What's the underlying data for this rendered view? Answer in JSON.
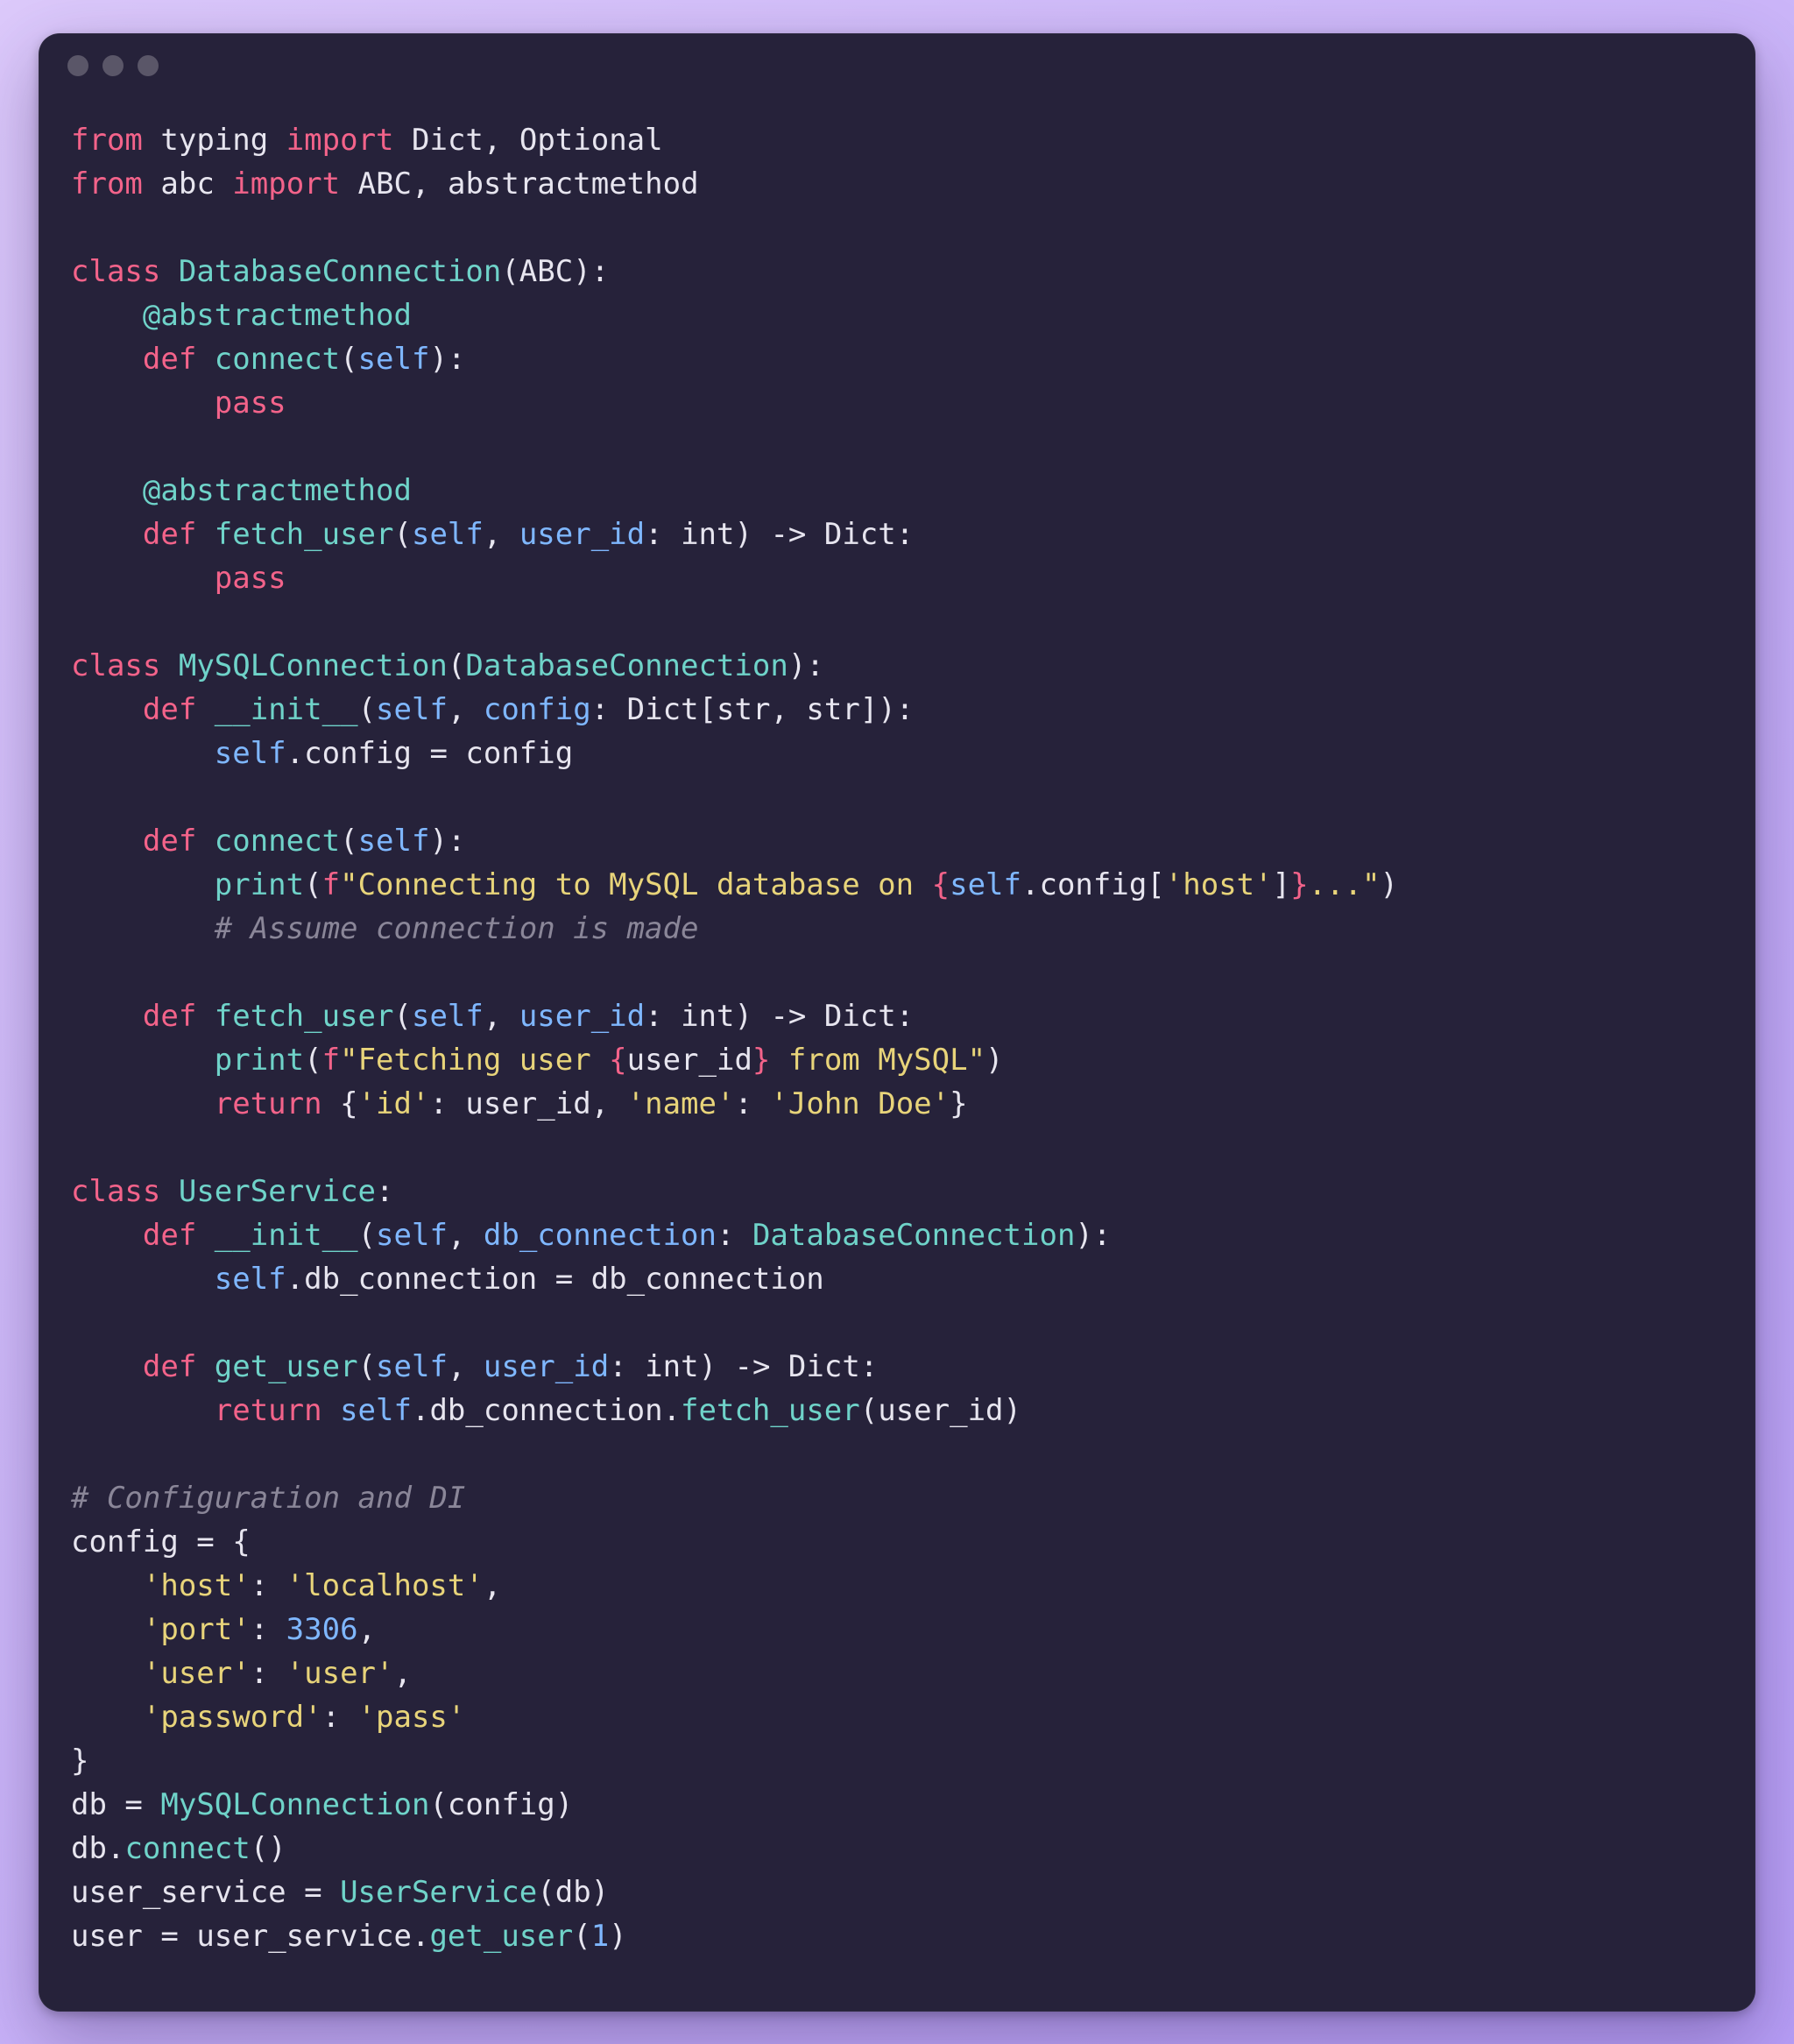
{
  "window": {
    "traffic_light_color_red": "#ff5f56",
    "traffic_light_color_yellow": "#ffbd2e",
    "traffic_light_color_green": "#27c93f"
  },
  "code": {
    "language": "python",
    "tokens": [
      [
        [
          "kw",
          "from"
        ],
        [
          "pun",
          " "
        ],
        [
          "pun",
          "typing"
        ],
        [
          "pun",
          " "
        ],
        [
          "kw",
          "import"
        ],
        [
          "pun",
          " "
        ],
        [
          "pun",
          "Dict"
        ],
        [
          "pun",
          ", "
        ],
        [
          "pun",
          "Optional"
        ]
      ],
      [
        [
          "kw",
          "from"
        ],
        [
          "pun",
          " "
        ],
        [
          "pun",
          "abc"
        ],
        [
          "pun",
          " "
        ],
        [
          "kw",
          "import"
        ],
        [
          "pun",
          " "
        ],
        [
          "pun",
          "ABC"
        ],
        [
          "pun",
          ", "
        ],
        [
          "pun",
          "abstractmethod"
        ]
      ],
      [],
      [
        [
          "kw",
          "class"
        ],
        [
          "pun",
          " "
        ],
        [
          "cls",
          "DatabaseConnection"
        ],
        [
          "pun",
          "("
        ],
        [
          "pun",
          "ABC"
        ],
        [
          "pun",
          "):"
        ]
      ],
      [
        [
          "pun",
          "    "
        ],
        [
          "dec",
          "@abstractmethod"
        ]
      ],
      [
        [
          "pun",
          "    "
        ],
        [
          "kw",
          "def"
        ],
        [
          "pun",
          " "
        ],
        [
          "fn",
          "connect"
        ],
        [
          "pun",
          "("
        ],
        [
          "self",
          "self"
        ],
        [
          "pun",
          "):"
        ]
      ],
      [
        [
          "pun",
          "        "
        ],
        [
          "kw",
          "pass"
        ]
      ],
      [],
      [
        [
          "pun",
          "    "
        ],
        [
          "dec",
          "@abstractmethod"
        ]
      ],
      [
        [
          "pun",
          "    "
        ],
        [
          "kw",
          "def"
        ],
        [
          "pun",
          " "
        ],
        [
          "fn",
          "fetch_user"
        ],
        [
          "pun",
          "("
        ],
        [
          "self",
          "self"
        ],
        [
          "pun",
          ", "
        ],
        [
          "param",
          "user_id"
        ],
        [
          "pun",
          ": "
        ],
        [
          "type",
          "int"
        ],
        [
          "pun",
          ") -> "
        ],
        [
          "type",
          "Dict"
        ],
        [
          "pun",
          ":"
        ]
      ],
      [
        [
          "pun",
          "        "
        ],
        [
          "kw",
          "pass"
        ]
      ],
      [],
      [
        [
          "kw",
          "class"
        ],
        [
          "pun",
          " "
        ],
        [
          "cls",
          "MySQLConnection"
        ],
        [
          "pun",
          "("
        ],
        [
          "cls",
          "DatabaseConnection"
        ],
        [
          "pun",
          "):"
        ]
      ],
      [
        [
          "pun",
          "    "
        ],
        [
          "kw",
          "def"
        ],
        [
          "pun",
          " "
        ],
        [
          "fn",
          "__init__"
        ],
        [
          "pun",
          "("
        ],
        [
          "self",
          "self"
        ],
        [
          "pun",
          ", "
        ],
        [
          "param",
          "config"
        ],
        [
          "pun",
          ": "
        ],
        [
          "type",
          "Dict"
        ],
        [
          "pun",
          "["
        ],
        [
          "type",
          "str"
        ],
        [
          "pun",
          ", "
        ],
        [
          "type",
          "str"
        ],
        [
          "pun",
          "]):"
        ]
      ],
      [
        [
          "pun",
          "        "
        ],
        [
          "self",
          "self"
        ],
        [
          "pun",
          "."
        ],
        [
          "attr",
          "config"
        ],
        [
          "pun",
          " = "
        ],
        [
          "pun",
          "config"
        ]
      ],
      [],
      [
        [
          "pun",
          "    "
        ],
        [
          "kw",
          "def"
        ],
        [
          "pun",
          " "
        ],
        [
          "fn",
          "connect"
        ],
        [
          "pun",
          "("
        ],
        [
          "self",
          "self"
        ],
        [
          "pun",
          "):"
        ]
      ],
      [
        [
          "pun",
          "        "
        ],
        [
          "fn",
          "print"
        ],
        [
          "pun",
          "("
        ],
        [
          "kw",
          "f"
        ],
        [
          "str",
          "\"Connecting to MySQL database on "
        ],
        [
          "fbr",
          "{"
        ],
        [
          "self",
          "self"
        ],
        [
          "pun",
          "."
        ],
        [
          "attr",
          "config"
        ],
        [
          "pun",
          "["
        ],
        [
          "str",
          "'host'"
        ],
        [
          "pun",
          "]"
        ],
        [
          "fbr",
          "}"
        ],
        [
          "str",
          "...\""
        ],
        [
          "pun",
          ")"
        ]
      ],
      [
        [
          "pun",
          "        "
        ],
        [
          "cmt",
          "# Assume connection is made"
        ]
      ],
      [],
      [
        [
          "pun",
          "    "
        ],
        [
          "kw",
          "def"
        ],
        [
          "pun",
          " "
        ],
        [
          "fn",
          "fetch_user"
        ],
        [
          "pun",
          "("
        ],
        [
          "self",
          "self"
        ],
        [
          "pun",
          ", "
        ],
        [
          "param",
          "user_id"
        ],
        [
          "pun",
          ": "
        ],
        [
          "type",
          "int"
        ],
        [
          "pun",
          ") -> "
        ],
        [
          "type",
          "Dict"
        ],
        [
          "pun",
          ":"
        ]
      ],
      [
        [
          "pun",
          "        "
        ],
        [
          "fn",
          "print"
        ],
        [
          "pun",
          "("
        ],
        [
          "kw",
          "f"
        ],
        [
          "str",
          "\"Fetching user "
        ],
        [
          "fbr",
          "{"
        ],
        [
          "pun",
          "user_id"
        ],
        [
          "fbr",
          "}"
        ],
        [
          "str",
          " from MySQL\""
        ],
        [
          "pun",
          ")"
        ]
      ],
      [
        [
          "pun",
          "        "
        ],
        [
          "kw",
          "return"
        ],
        [
          "pun",
          " {"
        ],
        [
          "str",
          "'id'"
        ],
        [
          "pun",
          ": "
        ],
        [
          "pun",
          "user_id"
        ],
        [
          "pun",
          ", "
        ],
        [
          "str",
          "'name'"
        ],
        [
          "pun",
          ": "
        ],
        [
          "str",
          "'John Doe'"
        ],
        [
          "pun",
          "}"
        ]
      ],
      [],
      [
        [
          "kw",
          "class"
        ],
        [
          "pun",
          " "
        ],
        [
          "cls",
          "UserService"
        ],
        [
          "pun",
          ":"
        ]
      ],
      [
        [
          "pun",
          "    "
        ],
        [
          "kw",
          "def"
        ],
        [
          "pun",
          " "
        ],
        [
          "fn",
          "__init__"
        ],
        [
          "pun",
          "("
        ],
        [
          "self",
          "self"
        ],
        [
          "pun",
          ", "
        ],
        [
          "param",
          "db_connection"
        ],
        [
          "pun",
          ": "
        ],
        [
          "cls",
          "DatabaseConnection"
        ],
        [
          "pun",
          "):"
        ]
      ],
      [
        [
          "pun",
          "        "
        ],
        [
          "self",
          "self"
        ],
        [
          "pun",
          "."
        ],
        [
          "attr",
          "db_connection"
        ],
        [
          "pun",
          " = "
        ],
        [
          "pun",
          "db_connection"
        ]
      ],
      [],
      [
        [
          "pun",
          "    "
        ],
        [
          "kw",
          "def"
        ],
        [
          "pun",
          " "
        ],
        [
          "fn",
          "get_user"
        ],
        [
          "pun",
          "("
        ],
        [
          "self",
          "self"
        ],
        [
          "pun",
          ", "
        ],
        [
          "param",
          "user_id"
        ],
        [
          "pun",
          ": "
        ],
        [
          "type",
          "int"
        ],
        [
          "pun",
          ") -> "
        ],
        [
          "type",
          "Dict"
        ],
        [
          "pun",
          ":"
        ]
      ],
      [
        [
          "pun",
          "        "
        ],
        [
          "kw",
          "return"
        ],
        [
          "pun",
          " "
        ],
        [
          "self",
          "self"
        ],
        [
          "pun",
          "."
        ],
        [
          "attr",
          "db_connection"
        ],
        [
          "pun",
          "."
        ],
        [
          "fn",
          "fetch_user"
        ],
        [
          "pun",
          "("
        ],
        [
          "pun",
          "user_id"
        ],
        [
          "pun",
          ")"
        ]
      ],
      [],
      [
        [
          "cmt",
          "# Configuration and DI"
        ]
      ],
      [
        [
          "pun",
          "config"
        ],
        [
          "pun",
          " = {"
        ]
      ],
      [
        [
          "pun",
          "    "
        ],
        [
          "str",
          "'host'"
        ],
        [
          "pun",
          ": "
        ],
        [
          "str",
          "'localhost'"
        ],
        [
          "pun",
          ","
        ]
      ],
      [
        [
          "pun",
          "    "
        ],
        [
          "str",
          "'port'"
        ],
        [
          "pun",
          ": "
        ],
        [
          "num",
          "3306"
        ],
        [
          "pun",
          ","
        ]
      ],
      [
        [
          "pun",
          "    "
        ],
        [
          "str",
          "'user'"
        ],
        [
          "pun",
          ": "
        ],
        [
          "str",
          "'user'"
        ],
        [
          "pun",
          ","
        ]
      ],
      [
        [
          "pun",
          "    "
        ],
        [
          "str",
          "'password'"
        ],
        [
          "pun",
          ": "
        ],
        [
          "str",
          "'pass'"
        ]
      ],
      [
        [
          "pun",
          "}"
        ]
      ],
      [
        [
          "pun",
          "db"
        ],
        [
          "pun",
          " = "
        ],
        [
          "cls",
          "MySQLConnection"
        ],
        [
          "pun",
          "("
        ],
        [
          "pun",
          "config"
        ],
        [
          "pun",
          ")"
        ]
      ],
      [
        [
          "pun",
          "db"
        ],
        [
          "pun",
          "."
        ],
        [
          "fn",
          "connect"
        ],
        [
          "pun",
          "()"
        ]
      ],
      [
        [
          "pun",
          "user_service"
        ],
        [
          "pun",
          " = "
        ],
        [
          "cls",
          "UserService"
        ],
        [
          "pun",
          "("
        ],
        [
          "pun",
          "db"
        ],
        [
          "pun",
          ")"
        ]
      ],
      [
        [
          "pun",
          "user"
        ],
        [
          "pun",
          " = "
        ],
        [
          "pun",
          "user_service"
        ],
        [
          "pun",
          "."
        ],
        [
          "fn",
          "get_user"
        ],
        [
          "pun",
          "("
        ],
        [
          "num",
          "1"
        ],
        [
          "pun",
          ")"
        ]
      ]
    ]
  }
}
